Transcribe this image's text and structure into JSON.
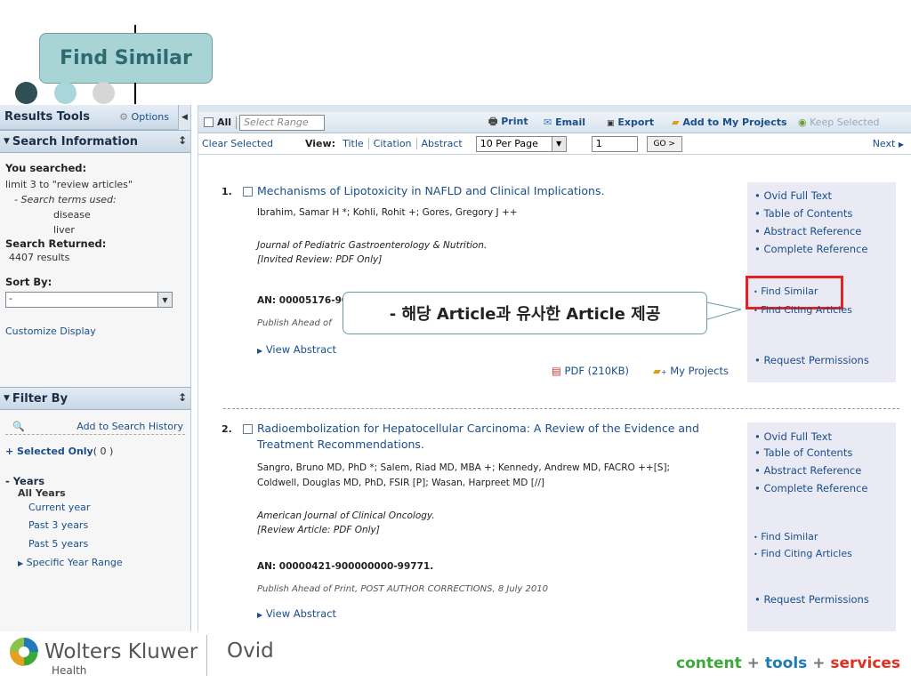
{
  "title": "Find Similar",
  "callout": "- 해당 Article과 유사한 Article 제공",
  "sidebar": {
    "results_tools": "Results Tools",
    "options": "Options",
    "search_information": "Search Information",
    "you_searched": "You searched:",
    "limit_text": "limit 3 to \"review articles\"",
    "search_terms_used": "- Search terms used:",
    "terms": [
      "disease",
      "liver"
    ],
    "search_returned": "Search Returned:",
    "results_count": "4407 results",
    "sort_by": "Sort By:",
    "sort_value": "-",
    "customize_display": "Customize Display",
    "filter_by": "Filter By",
    "add_to_search_history": "Add to Search History",
    "selected_only": "+ Selected Only",
    "selected_count": "( 0 )",
    "years": "- Years",
    "all_years": "All Years",
    "year_options": [
      "Current year",
      "Past 3 years",
      "Past 5 years"
    ],
    "specific_year_range": "Specific Year Range"
  },
  "toolbar": {
    "all": "All",
    "select_range_placeholder": "Select Range",
    "print": "Print",
    "email": "Email",
    "export": "Export",
    "add_to_my_projects": "Add to My Projects",
    "keep_selected": "Keep Selected",
    "clear_selected": "Clear Selected",
    "view_label": "View:",
    "view_tabs": [
      "Title",
      "Citation",
      "Abstract"
    ],
    "per_page": "10 Per Page",
    "page_number": "1",
    "go": "GO >",
    "next": "Next"
  },
  "results": [
    {
      "number": "1.",
      "title": "Mechanisms of Lipotoxicity in NAFLD and Clinical Implications.",
      "authors": "Ibrahim, Samar H *; Kohli, Rohit +; Gores, Gregory J ++",
      "journal": "Journal of Pediatric Gastroenterology & Nutrition.",
      "type": "[Invited Review: PDF Only]",
      "an": "AN: 00005176-90",
      "pub": "Publish Ahead of",
      "view_abstract": "View Abstract",
      "pdf": "PDF (210KB)",
      "my_projects": "My Projects",
      "links": [
        "Ovid Full Text",
        "Table of Contents",
        "Abstract Reference",
        "Complete Reference"
      ],
      "find_similar": "Find Similar",
      "find_citing": "Find Citing Articles",
      "request_permissions": "Request Permissions"
    },
    {
      "number": "2.",
      "title": "Radioembolization for Hepatocellular Carcinoma: A Review of the Evidence and Treatment Recommendations.",
      "authors_1": "Sangro, Bruno MD, PhD *; Salem, Riad MD, MBA +; Kennedy, Andrew MD, FACRO ++[S];",
      "authors_2": "Coldwell, Douglas MD, PhD, FSIR [P]; Wasan, Harpreet MD [//]",
      "journal": "American Journal of Clinical Oncology.",
      "type": "[Review Article: PDF Only]",
      "an": "AN: 00000421-900000000-99771.",
      "pub": "Publish Ahead of Print, POST AUTHOR CORRECTIONS, 8 July 2010",
      "view_abstract": "View Abstract",
      "links": [
        "Ovid Full Text",
        "Table of Contents",
        "Abstract Reference",
        "Complete Reference"
      ],
      "find_similar": "Find Similar",
      "find_citing": "Find Citing Articles",
      "request_permissions": "Request Permissions"
    }
  ],
  "footer": {
    "brand": "Wolters Kluwer",
    "brand_sub": "Health",
    "product": "Ovid",
    "tagline_content": "content",
    "tagline_tools": "tools",
    "tagline_services": "services",
    "plus": "+"
  },
  "colors": {
    "accent_teal": "#2e6b70",
    "link_blue": "#1a4e8c",
    "highlight_red": "#e32222",
    "tagline_green": "#3aaa35",
    "tagline_blue": "#1f7ab7",
    "tagline_red": "#e1301f"
  }
}
